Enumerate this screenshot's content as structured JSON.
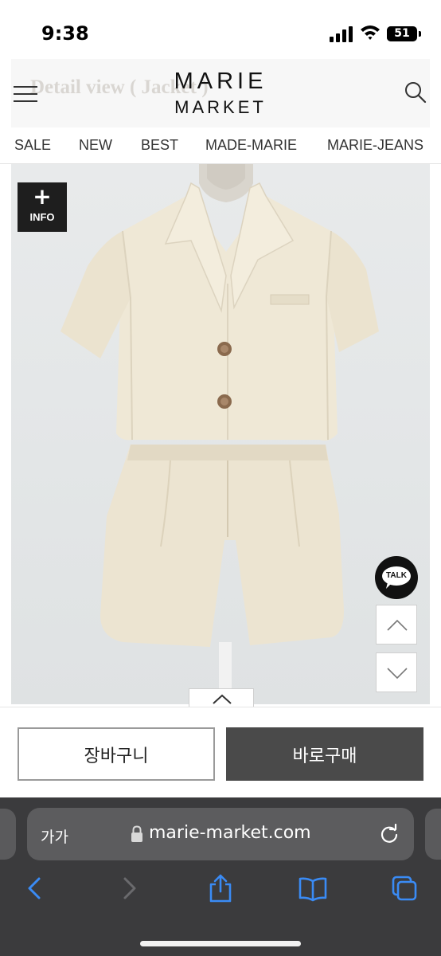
{
  "status_bar": {
    "time": "9:38",
    "battery_percent": 51,
    "battery_text": "51"
  },
  "header": {
    "ghost_text": "Detail view ( Jacket )",
    "logo_line1": "MARIE",
    "logo_line2": "MARKET",
    "menu_icon": "hamburger-menu-icon",
    "search_icon": "search-icon"
  },
  "nav": {
    "items": [
      "SALE",
      "NEW",
      "BEST",
      "MADE-MARIE",
      "MARIE-JEANS"
    ]
  },
  "product": {
    "info_badge_symbol": "+",
    "info_badge_label": "INFO",
    "talk_label": "TALK"
  },
  "buy_bar": {
    "cart_label": "장바구니",
    "buy_now_label": "바로구매"
  },
  "browser": {
    "text_size_label": "가가",
    "url": "marie-market.com",
    "toolbar_icons": [
      "back-icon",
      "forward-icon",
      "share-icon",
      "bookmarks-icon",
      "tabs-icon"
    ]
  },
  "colors": {
    "header_bg": "#f7f7f7",
    "buy_now_bg": "#4a4a4a",
    "browser_bg": "#3b3b3d",
    "accent_blue": "#3a8bf5",
    "garment": "#ece4d1"
  }
}
